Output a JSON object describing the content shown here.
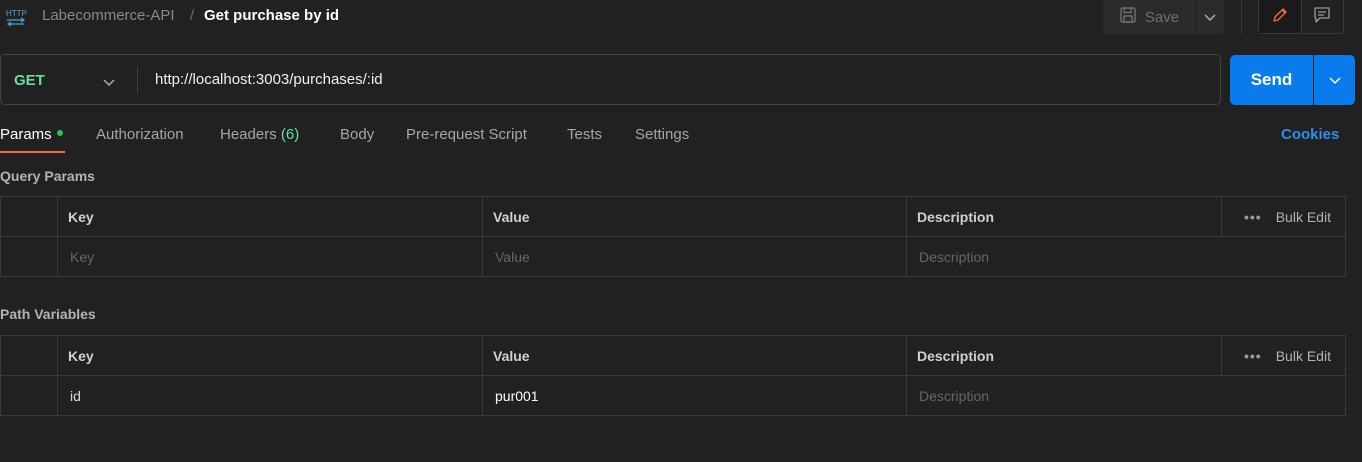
{
  "breadcrumb": {
    "icon": "http-icon",
    "parent": "Labecommerce-API",
    "separator": "/",
    "current": "Get purchase by id"
  },
  "toolbar": {
    "save_label": "Save",
    "save_icon": "floppy-disk-icon",
    "edit_icon": "pencil-icon",
    "comments_icon": "comment-icon"
  },
  "request": {
    "method": "GET",
    "url": "http://localhost:3003/purchases/:id",
    "send_label": "Send"
  },
  "tabs": [
    {
      "label": "Params",
      "active": true,
      "dot": true
    },
    {
      "label": "Authorization"
    },
    {
      "label": "Headers",
      "count": "(6)"
    },
    {
      "label": "Body"
    },
    {
      "label": "Pre-request Script"
    },
    {
      "label": "Tests"
    },
    {
      "label": "Settings"
    }
  ],
  "cookies_label": "Cookies",
  "query_params": {
    "title": "Query Params",
    "headers": {
      "key": "Key",
      "value": "Value",
      "description": "Description",
      "bulk_edit": "Bulk Edit"
    },
    "placeholders": {
      "key": "Key",
      "value": "Value",
      "description": "Description"
    }
  },
  "path_variables": {
    "title": "Path Variables",
    "headers": {
      "key": "Key",
      "value": "Value",
      "description": "Description",
      "bulk_edit": "Bulk Edit"
    },
    "rows": [
      {
        "key": "id",
        "value": "pur001",
        "description_placeholder": "Description"
      }
    ]
  },
  "colors": {
    "accent_orange": "#f26b3a",
    "send_blue": "#097bed",
    "method_green": "#6bdd9a",
    "cookies_blue": "#2f8cf0"
  }
}
